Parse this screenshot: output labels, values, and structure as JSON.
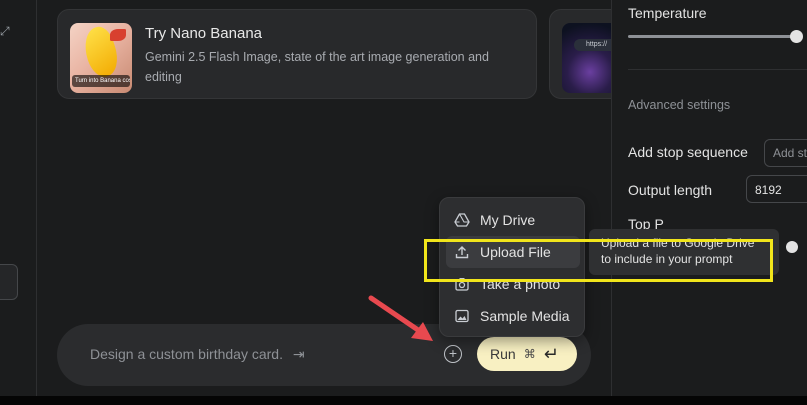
{
  "cards": [
    {
      "title": "Try Nano Banana",
      "description": "Gemini 2.5 Flash Image, state of the art image generation and editing",
      "thumb_caption": "Turn into Banana cost"
    },
    {
      "thumb_url": "https://"
    }
  ],
  "prompt": {
    "placeholder": "Design a custom birthday card.",
    "tab_hint": "⇥",
    "run_label": "Run",
    "run_shortcut": "⌘",
    "run_enter_glyph": "↵"
  },
  "attach_menu": {
    "items": [
      {
        "label": "My Drive",
        "icon": "drive-icon"
      },
      {
        "label": "Upload File",
        "icon": "upload-icon"
      },
      {
        "label": "Take a photo",
        "icon": "camera-icon"
      },
      {
        "label": "Sample Media",
        "icon": "image-icon"
      }
    ]
  },
  "tooltip": {
    "line1": "Upload a file to Google Drive",
    "line2": "to include in your prompt"
  },
  "right_panel": {
    "temperature_label": "Temperature",
    "temperature_level": 0.98,
    "advanced_settings_label": "Advanced settings",
    "stop_sequence_label": "Add stop sequence",
    "stop_sequence_placeholder": "Add stop...",
    "output_length_label": "Output length",
    "output_length_value": "8192",
    "top_p_label": "Top P"
  },
  "colors": {
    "highlight": "#f1e51b",
    "arrow": "#e8494f",
    "run_button": "#f8f0c2"
  }
}
